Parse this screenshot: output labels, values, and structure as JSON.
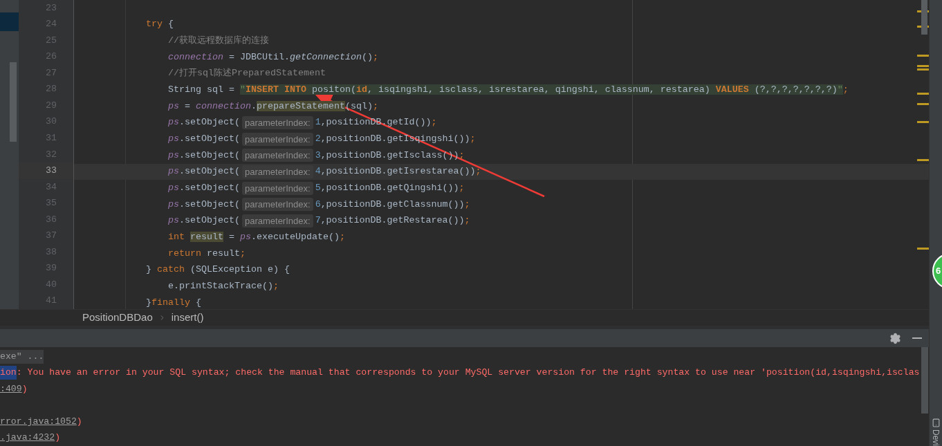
{
  "editor": {
    "code_lines": [
      {
        "number": "23",
        "current": false
      },
      {
        "number": "24",
        "current": false,
        "tokens": [
          {
            "text": "            try",
            "kind": "keyword"
          },
          {
            "text": " {",
            "kind": "plain"
          }
        ]
      },
      {
        "number": "25",
        "current": false,
        "tokens": [
          {
            "text": "                //获取远程数据库的连接",
            "kind": "comment"
          }
        ]
      },
      {
        "number": "26",
        "current": false,
        "tokens": [
          {
            "text": "                connection",
            "kind": "field"
          },
          {
            "text": " = JDBCUtil.",
            "kind": "plain"
          },
          {
            "text": "getConnection",
            "kind": "static_call"
          },
          {
            "text": "()",
            "kind": "plain"
          },
          {
            "text": ";",
            "kind": "punct"
          }
        ]
      },
      {
        "number": "27",
        "current": false,
        "tokens": [
          {
            "text": "                //打开sql陈述PreparedStatement",
            "kind": "comment"
          }
        ]
      },
      {
        "number": "28",
        "current": false,
        "tokens": [
          {
            "text": "                String sql = ",
            "kind": "plain"
          },
          {
            "text": "\"",
            "kind": "string"
          },
          {
            "text": "INSERT INTO",
            "kind": "sql_keyword"
          },
          {
            "text": " positon(",
            "kind": "sql"
          },
          {
            "text": "id",
            "kind": "sql_keyword"
          },
          {
            "text": ", isqingshi, isclass, isrestarea, qingshi, classnum, restarea) ",
            "kind": "sql"
          },
          {
            "text": "VALUES",
            "kind": "sql_keyword"
          },
          {
            "text": " (?,?,?,?,?,?,?)",
            "kind": "sql"
          },
          {
            "text": "\"",
            "kind": "string"
          },
          {
            "text": ";",
            "kind": "punct"
          }
        ]
      },
      {
        "number": "29",
        "current": false,
        "tokens": [
          {
            "text": "                ps",
            "kind": "field"
          },
          {
            "text": " = ",
            "kind": "plain"
          },
          {
            "text": "connection",
            "kind": "field"
          },
          {
            "text": ".",
            "kind": "plain"
          },
          {
            "text": "prepareStatement",
            "kind": "usage"
          },
          {
            "text": "(sql)",
            "kind": "plain"
          },
          {
            "text": ";",
            "kind": "punct"
          }
        ]
      },
      {
        "number": "30",
        "current": false,
        "tokens": [
          {
            "text": "                ps",
            "kind": "field"
          },
          {
            "text": ".setObject(",
            "kind": "plain"
          },
          {
            "text": "parameterIndex:",
            "kind": "hint"
          },
          {
            "text": "1",
            "kind": "number"
          },
          {
            "text": ",positionDB.getId())",
            "kind": "plain"
          },
          {
            "text": ";",
            "kind": "punct"
          }
        ]
      },
      {
        "number": "31",
        "current": false,
        "tokens": [
          {
            "text": "                ps",
            "kind": "field"
          },
          {
            "text": ".setObject(",
            "kind": "plain"
          },
          {
            "text": "parameterIndex:",
            "kind": "hint"
          },
          {
            "text": "2",
            "kind": "number"
          },
          {
            "text": ",positionDB.getIsqingshi())",
            "kind": "plain"
          },
          {
            "text": ";",
            "kind": "punct"
          }
        ]
      },
      {
        "number": "32",
        "current": false,
        "tokens": [
          {
            "text": "                ps",
            "kind": "field"
          },
          {
            "text": ".setObject(",
            "kind": "plain"
          },
          {
            "text": "parameterIndex:",
            "kind": "hint"
          },
          {
            "text": "3",
            "kind": "number"
          },
          {
            "text": ",positionDB.getIsclass())",
            "kind": "plain"
          },
          {
            "text": ";",
            "kind": "punct"
          }
        ]
      },
      {
        "number": "33",
        "current": true,
        "tokens": [
          {
            "text": "                ps",
            "kind": "field"
          },
          {
            "text": ".setObject(",
            "kind": "plain"
          },
          {
            "text": "parameterIndex:",
            "kind": "hint"
          },
          {
            "text": "4",
            "kind": "number"
          },
          {
            "text": ",positionDB.getIsrestarea())",
            "kind": "plain"
          },
          {
            "text": ";",
            "kind": "punct"
          }
        ]
      },
      {
        "number": "34",
        "current": false,
        "tokens": [
          {
            "text": "                ps",
            "kind": "field"
          },
          {
            "text": ".setObject(",
            "kind": "plain"
          },
          {
            "text": "parameterIndex:",
            "kind": "hint"
          },
          {
            "text": "5",
            "kind": "number"
          },
          {
            "text": ",positionDB.getQingshi())",
            "kind": "plain"
          },
          {
            "text": ";",
            "kind": "punct"
          }
        ]
      },
      {
        "number": "35",
        "current": false,
        "tokens": [
          {
            "text": "                ps",
            "kind": "field"
          },
          {
            "text": ".setObject(",
            "kind": "plain"
          },
          {
            "text": "parameterIndex:",
            "kind": "hint"
          },
          {
            "text": "6",
            "kind": "number"
          },
          {
            "text": ",positionDB.getClassnum())",
            "kind": "plain"
          },
          {
            "text": ";",
            "kind": "punct"
          }
        ]
      },
      {
        "number": "36",
        "current": false,
        "tokens": [
          {
            "text": "                ps",
            "kind": "field"
          },
          {
            "text": ".setObject(",
            "kind": "plain"
          },
          {
            "text": "parameterIndex:",
            "kind": "hint"
          },
          {
            "text": "7",
            "kind": "number"
          },
          {
            "text": ",positionDB.getRestarea())",
            "kind": "plain"
          },
          {
            "text": ";",
            "kind": "punct"
          }
        ]
      },
      {
        "number": "37",
        "current": false,
        "tokens": [
          {
            "text": "                int ",
            "kind": "keyword"
          },
          {
            "text": "result",
            "kind": "usage"
          },
          {
            "text": " = ",
            "kind": "plain"
          },
          {
            "text": "ps",
            "kind": "field"
          },
          {
            "text": ".executeUpdate()",
            "kind": "plain"
          },
          {
            "text": ";",
            "kind": "punct"
          }
        ]
      },
      {
        "number": "38",
        "current": false,
        "tokens": [
          {
            "text": "                return",
            "kind": "keyword"
          },
          {
            "text": " result",
            "kind": "plain"
          },
          {
            "text": ";",
            "kind": "punct"
          }
        ]
      },
      {
        "number": "39",
        "current": false,
        "tokens": [
          {
            "text": "            } ",
            "kind": "plain"
          },
          {
            "text": "catch",
            "kind": "keyword"
          },
          {
            "text": " (SQLException e) {",
            "kind": "plain"
          }
        ]
      },
      {
        "number": "40",
        "current": false,
        "tokens": [
          {
            "text": "                e.printStackTrace()",
            "kind": "plain"
          },
          {
            "text": ";",
            "kind": "punct"
          }
        ]
      },
      {
        "number": "41",
        "current": false,
        "tokens": [
          {
            "text": "            }",
            "kind": "plain"
          },
          {
            "text": "finally",
            "kind": "keyword"
          },
          {
            "text": " {",
            "kind": "plain"
          }
        ]
      }
    ],
    "breadcrumbs": [
      "PositionDBDao",
      "insert()"
    ]
  },
  "run_panel": {
    "console_lines": [
      {
        "segments": [
          {
            "text": "exe\" ...",
            "kind": "folded"
          }
        ]
      },
      {
        "segments": [
          {
            "text": "ion",
            "kind": "selected"
          },
          {
            "text": ": You have an error in your SQL syntax; check the manual that corresponds to your MySQL server version for the right syntax to use near 'position(id,isqingshi,isclas",
            "kind": "error"
          }
        ]
      },
      {
        "segments": [
          {
            "text": ":409",
            "kind": "link"
          },
          {
            "text": ")",
            "kind": "error"
          }
        ]
      },
      {
        "kind": "blank"
      },
      {
        "segments": [
          {
            "text": "rror.java:1052",
            "kind": "link"
          },
          {
            "text": ")",
            "kind": "error"
          }
        ]
      },
      {
        "segments": [
          {
            "text": ".java:4232",
            "kind": "link"
          },
          {
            "text": ")",
            "kind": "error"
          }
        ]
      }
    ]
  },
  "notification_badge": {
    "text": "6"
  },
  "side_tool": {
    "label": "Devi"
  }
}
